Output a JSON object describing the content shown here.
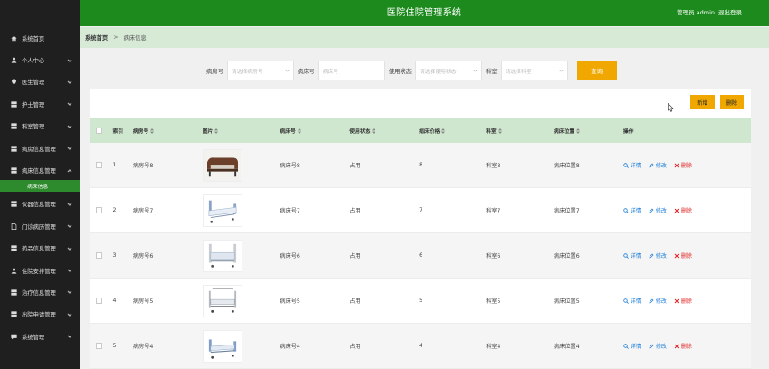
{
  "header": {
    "title": "医院住院管理系统",
    "user": "管理员 admin",
    "logout": "退出登录"
  },
  "sidebar": {
    "items": [
      {
        "label": "系统首页",
        "icon": "home-icon"
      },
      {
        "label": "个人中心",
        "icon": "user-icon"
      },
      {
        "label": "医生管理",
        "icon": "pin-icon"
      },
      {
        "label": "护士管理",
        "icon": "grid-icon"
      },
      {
        "label": "科室管理",
        "icon": "grid-icon"
      },
      {
        "label": "病房信息管理",
        "icon": "grid-icon"
      },
      {
        "label": "病床信息管理",
        "icon": "grid-icon"
      },
      {
        "label": "仪器信息管理",
        "icon": "grid-icon"
      },
      {
        "label": "门诊病历管理",
        "icon": "doc-icon"
      },
      {
        "label": "药品信息管理",
        "icon": "grid-icon"
      },
      {
        "label": "住院安排管理",
        "icon": "user-icon"
      },
      {
        "label": "治疗信息管理",
        "icon": "grid-icon"
      },
      {
        "label": "出院申请管理",
        "icon": "grid-icon"
      },
      {
        "label": "系统管理",
        "icon": "chat-icon"
      }
    ],
    "sub_item": "病床信息"
  },
  "breadcrumb": {
    "home": "系统首页",
    "sep": ">",
    "current": "病床信息"
  },
  "search": {
    "room_label": "病房号",
    "room_placeholder": "请选择病房号",
    "bed_label": "病床号",
    "bed_placeholder": "病床号",
    "status_label": "使用状态",
    "status_placeholder": "请选择使用状态",
    "dept_label": "科室",
    "dept_placeholder": "请选择科室",
    "query_button": "查询"
  },
  "actions": {
    "add": "新增",
    "delete": "删除"
  },
  "table": {
    "headers": {
      "index": "索引",
      "room": "病房号",
      "image": "图片",
      "bed": "病床号",
      "status": "使用状态",
      "price": "病床价格",
      "dept": "科室",
      "position": "病床位置",
      "op": "操作"
    },
    "ops": {
      "detail": "详情",
      "edit": "修改",
      "del": "删除"
    },
    "rows": [
      {
        "index": "1",
        "room": "病房号8",
        "bed": "病床号8",
        "status": "占用",
        "price": "8",
        "dept": "科室8",
        "position": "病床位置8"
      },
      {
        "index": "2",
        "room": "病房号7",
        "bed": "病床号7",
        "status": "占用",
        "price": "7",
        "dept": "科室7",
        "position": "病床位置7"
      },
      {
        "index": "3",
        "room": "病房号6",
        "bed": "病床号6",
        "status": "占用",
        "price": "6",
        "dept": "科室6",
        "position": "病床位置6"
      },
      {
        "index": "4",
        "room": "病房号5",
        "bed": "病床号5",
        "status": "占用",
        "price": "5",
        "dept": "科室5",
        "position": "病床位置5"
      },
      {
        "index": "5",
        "room": "病房号4",
        "bed": "病床号4",
        "status": "占用",
        "price": "4",
        "dept": "科室4",
        "position": "病床位置4"
      }
    ]
  },
  "colors": {
    "brand_green": "#1c8a1c",
    "accent_orange": "#f0a800",
    "sidebar_bg": "#1f1f1f",
    "link_blue": "#1e7fd6",
    "danger_red": "#e02020"
  }
}
